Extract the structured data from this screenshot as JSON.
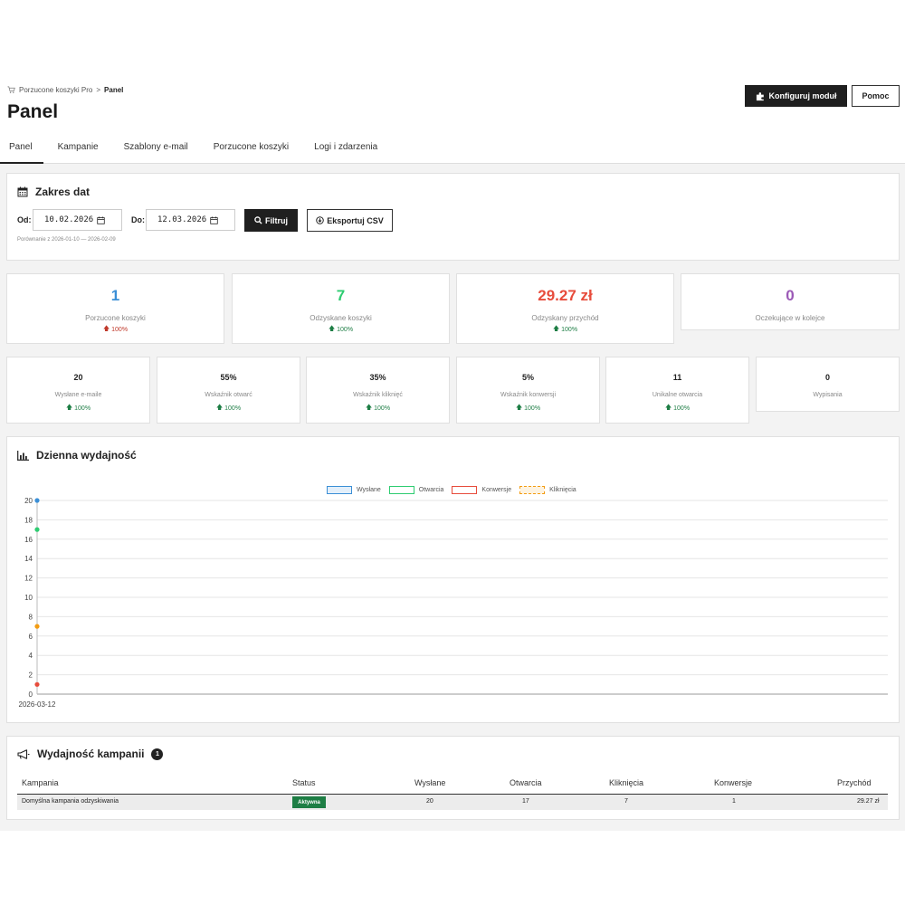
{
  "breadcrumb": {
    "parent": "Porzucone koszyki Pro",
    "separator": ">",
    "current": "Panel"
  },
  "header": {
    "title": "Panel",
    "config_button": "Konfiguruj moduł",
    "help_button": "Pomoc"
  },
  "tabs": [
    {
      "label": "Panel",
      "active": true
    },
    {
      "label": "Kampanie"
    },
    {
      "label": "Szablony e-mail"
    },
    {
      "label": "Porzucone koszyki"
    },
    {
      "label": "Logi i zdarzenia"
    }
  ],
  "date_range": {
    "title": "Zakres dat",
    "from_label": "Od:",
    "from_value": "10.02.2026",
    "to_label": "Do:",
    "to_value": "12.03.2026",
    "filter_button": "Filtruj",
    "export_button": "Eksportuj CSV",
    "comparison": "Porównanie z 2026-01-10 — 2026-02-09"
  },
  "main_stats": [
    {
      "value": "1",
      "label": "Porzucone koszyki",
      "trend": "100%",
      "color": "#3b8fd6",
      "trend_color": "#c0392b"
    },
    {
      "value": "7",
      "label": "Odzyskane koszyki",
      "trend": "100%",
      "color": "#2ecc71",
      "trend_color": "#1e7e45"
    },
    {
      "value": "29.27 zł",
      "label": "Odzyskany przychód",
      "trend": "100%",
      "color": "#e74c3c",
      "trend_color": "#1e7e45"
    },
    {
      "value": "0",
      "label": "Oczekujące w kolejce",
      "trend": "",
      "color": "#9b59b6",
      "trend_color": "#1e7e45"
    }
  ],
  "email_stats": [
    {
      "value": "20",
      "label": "Wysłane e-maile",
      "trend": "100%"
    },
    {
      "value": "55%",
      "label": "Wskaźnik otwarć",
      "trend": "100%"
    },
    {
      "value": "35%",
      "label": "Wskaźnik kliknięć",
      "trend": "100%"
    },
    {
      "value": "5%",
      "label": "Wskaźnik konwersji",
      "trend": "100%"
    },
    {
      "value": "11",
      "label": "Unikalne otwarcia",
      "trend": "100%"
    },
    {
      "value": "0",
      "label": "Wypisania",
      "trend": ""
    }
  ],
  "chart_section": {
    "title": "Dzienna wydajność"
  },
  "chart_data": {
    "type": "line",
    "x": [
      "2026-03-12"
    ],
    "ylim": [
      0,
      20
    ],
    "yticks": [
      0,
      2,
      4,
      6,
      8,
      10,
      12,
      14,
      16,
      18,
      20
    ],
    "grid": true,
    "legend": "top-center",
    "series": [
      {
        "name": "Wysłane",
        "values": [
          20
        ],
        "color": "#3b8fd6"
      },
      {
        "name": "Otwarcia",
        "values": [
          17
        ],
        "color": "#2ecc71"
      },
      {
        "name": "Konwersje",
        "values": [
          1
        ],
        "color": "#e74c3c"
      },
      {
        "name": "Kliknięcia",
        "values": [
          7
        ],
        "color": "#f39c12",
        "dashed": true
      }
    ]
  },
  "campaigns": {
    "title": "Wydajność kampanii",
    "count": "1",
    "columns": [
      "Kampania",
      "Status",
      "Wysłane",
      "Otwarcia",
      "Kliknięcia",
      "Konwersje",
      "Przychód"
    ],
    "rows": [
      {
        "name": "Domyślna kampania odzyskiwania",
        "status": "Aktywna",
        "sent": "20",
        "opens": "17",
        "clicks": "7",
        "conversions": "1",
        "revenue": "29.27 zł"
      }
    ]
  }
}
